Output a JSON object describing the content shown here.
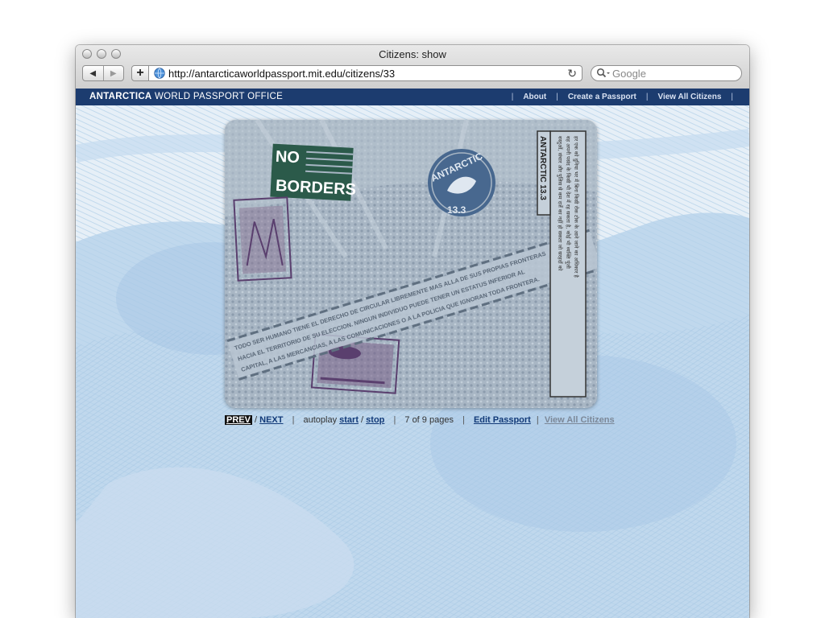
{
  "window": {
    "title": "Citizens: show"
  },
  "toolbar": {
    "back_icon": "back-arrow-icon",
    "forward_icon": "forward-arrow-icon",
    "add_label": "+",
    "url": "http://antarcticaworldpassport.mit.edu/citizens/33",
    "reload_glyph": "↻",
    "search_placeholder": "Google"
  },
  "site": {
    "brand_bold": "ANTARCTICA",
    "brand_rest": " WORLD PASSPORT OFFICE",
    "nav": [
      "About",
      "Create a Passport",
      "View All Citizens"
    ],
    "nav_separator": "|"
  },
  "passport": {
    "stamp_no_borders_line1": "NO",
    "stamp_no_borders_line2": "BORDERS",
    "seal_word": "ANTARCTIC",
    "seal_number": "13.3",
    "side_stamp_label": "ANTARCTIC 13.3",
    "banner_line1": "TODO SER HUMANO TIENE EL DERECHO DE CIRCULAR LIBREMENTE MAS ALLA DE SUS PROPIAS FRONTERAS",
    "banner_line2": "HACIA EL TERRITORIO DE SU ELECCION. NINGUN INDIVIDUO PUEDE TENER UN ESTATUS INFERIOR AL",
    "banner_line3": "CAPITAL, A LAS MERCANCIAS, A LAS COMUNICACIONES O A LA POLICIA QUE IGNORAN TODA FRONTERA.",
    "hindi_lines": [
      "हर एक को दुनिया भर में बिना किसी रोक टोक के आने जाने का अधिकार है",
      "वह अपनी पसंद के किसी भी देश में रह सकता है, कोई भी व्यक्ति पूंजी",
      "वस्तुओं, संचार और पुलिस से कम दर्जे का नहीं हो सकता जो सरहदों को"
    ]
  },
  "pager": {
    "prev": "PREV",
    "slash": "/",
    "next": "NEXT",
    "autoplay": "autoplay",
    "start": "start",
    "stop": "stop",
    "pages": "7 of 9 pages",
    "edit": "Edit Passport",
    "view_all": "View All Citizens",
    "separator": "|"
  },
  "colors": {
    "site_bar": "#1c3c6f",
    "stamp_green": "#2b5a4a",
    "seal_blue": "#48688f",
    "stamp_purple": "#5a3f6e"
  }
}
